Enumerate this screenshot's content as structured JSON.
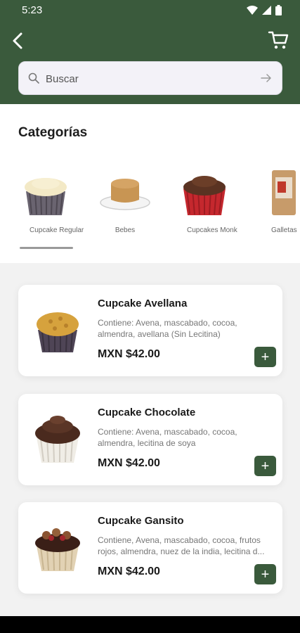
{
  "status_bar": {
    "time": "5:23"
  },
  "header": {
    "back_icon": "chevron-left-icon",
    "cart_icon": "shopping-cart-icon",
    "background_color": "#3a5a3c"
  },
  "search": {
    "placeholder": "Buscar",
    "value": ""
  },
  "categories": {
    "title": "Categorías",
    "items": [
      {
        "label": "Cupcake Regular"
      },
      {
        "label": "Bebes"
      },
      {
        "label": "Cupcakes Monk"
      },
      {
        "label": "Galletas"
      }
    ]
  },
  "products": [
    {
      "name": "Cupcake Avellana",
      "description": "Contiene: Avena, mascabado, cocoa, almendra, avellana (Sin Lecitina)",
      "price": "MXN $42.00",
      "add_label": "+"
    },
    {
      "name": "Cupcake Chocolate",
      "description": "Contiene: Avena, mascabado, cocoa, almendra, lecitina de soya",
      "price": "MXN $42.00",
      "add_label": "+"
    },
    {
      "name": "Cupcake Gansito",
      "description": "Contiene, Avena, mascabado, cocoa, frutos rojos, almendra, nuez de la india, lecitina d...",
      "price": "MXN $42.00",
      "add_label": "+"
    }
  ]
}
